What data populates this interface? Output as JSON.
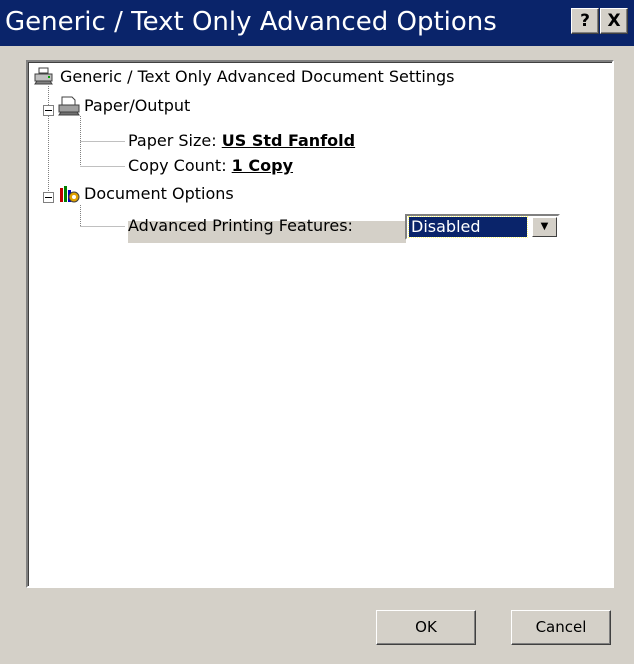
{
  "window": {
    "title": "Generic / Text Only Advanced Options",
    "help_label": "?",
    "close_label": "X"
  },
  "tree": {
    "root": {
      "label": "Generic / Text Only Advanced Document Settings",
      "icon": "printer-icon"
    },
    "paper_output": {
      "label": "Paper/Output",
      "icon": "paper-output-icon",
      "paper_size": {
        "label": "Paper Size:",
        "value": "US Std Fanfold"
      },
      "copy_count": {
        "label": "Copy Count:",
        "value": "1 Copy"
      }
    },
    "document_options": {
      "label": "Document Options",
      "icon": "document-options-icon",
      "advanced_printing": {
        "label": "Advanced Printing Features:",
        "value": "Disabled"
      }
    }
  },
  "buttons": {
    "ok": "OK",
    "cancel": "Cancel"
  },
  "colors": {
    "titlebar": "#0a246a",
    "selection": "#0a246a",
    "dialog_bg": "#d4d0c8"
  }
}
